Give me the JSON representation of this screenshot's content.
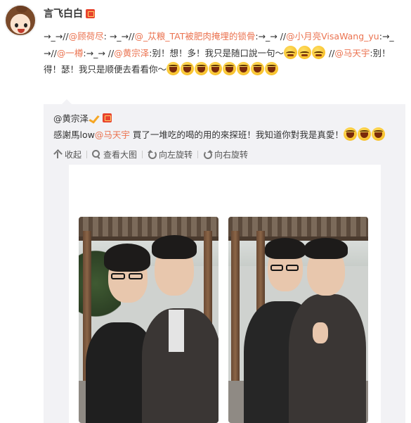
{
  "post": {
    "author": "言飞白白",
    "segments": [
      {
        "type": "text",
        "value": "→_→//"
      },
      {
        "type": "mention",
        "value": "@顾荷尽"
      },
      {
        "type": "text",
        "value": ": →_→//"
      },
      {
        "type": "mention",
        "value": "@_苁粮_TAT被肥肉掩埋的锁骨"
      },
      {
        "type": "text",
        "value": ":→_→ //"
      },
      {
        "type": "mention",
        "value": "@小月亮VisaWang_yu"
      },
      {
        "type": "text",
        "value": ":→_→//"
      },
      {
        "type": "mention",
        "value": "@一樽"
      },
      {
        "type": "text",
        "value": ":→_→ //"
      },
      {
        "type": "mention",
        "value": "@黄宗泽"
      },
      {
        "type": "text",
        "value": ":别！想！多！我只是随口說一句～"
      },
      {
        "type": "emoji",
        "value": "shy-emoji"
      },
      {
        "type": "emoji",
        "value": "shy-emoji"
      },
      {
        "type": "emoji",
        "value": "shy-emoji"
      },
      {
        "type": "text",
        "value": " //"
      },
      {
        "type": "mention",
        "value": "@马天宇"
      },
      {
        "type": "text",
        "value": ":别！得！瑟！我只是顺便去看看你～"
      },
      {
        "type": "emoji",
        "value": "laugh-emoji"
      },
      {
        "type": "emoji",
        "value": "laugh-emoji"
      },
      {
        "type": "emoji",
        "value": "laugh-emoji"
      },
      {
        "type": "emoji",
        "value": "laugh-emoji"
      },
      {
        "type": "emoji",
        "value": "laugh-emoji"
      },
      {
        "type": "emoji",
        "value": "laugh-emoji"
      },
      {
        "type": "emoji",
        "value": "laugh-emoji"
      },
      {
        "type": "emoji",
        "value": "laugh-emoji"
      }
    ]
  },
  "repost": {
    "author": "@黄宗泽",
    "text_before": "感謝馬low",
    "mention": "@马天宇",
    "text_after": " 買了一堆吃的喝的用的來探班！我知道你對我是真愛！",
    "emoji_count": 3,
    "tools": {
      "collapse": "收起",
      "view_large": "查看大图",
      "rotate_left": "向左旋转",
      "rotate_right": "向右旋转"
    }
  },
  "colors": {
    "mention": "#eb7350",
    "repost_bg": "#f2f2f5",
    "text": "#333333"
  }
}
